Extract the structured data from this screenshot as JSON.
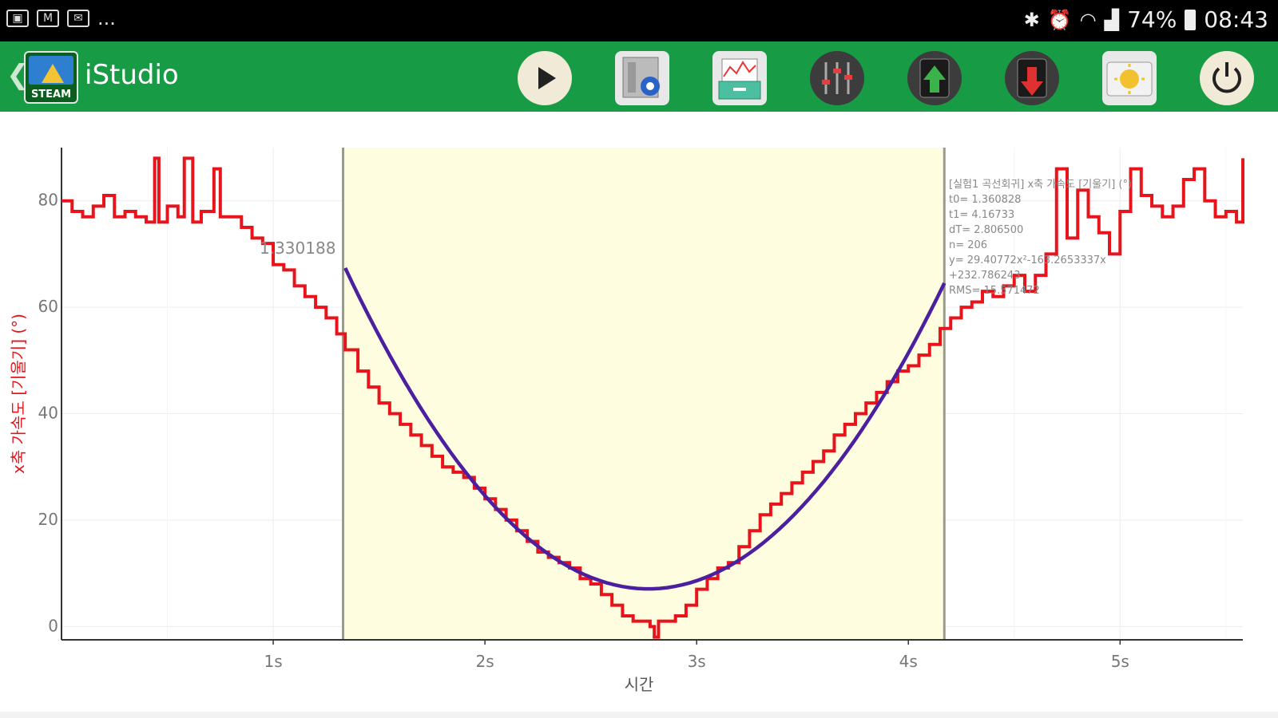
{
  "status_bar": {
    "overflow": "...",
    "battery": "74%",
    "time": "08:43",
    "left_icons": [
      "gallery-icon",
      "gmail-icon",
      "mail-icon"
    ],
    "right_icons": [
      "bluetooth-icon",
      "alarm-icon",
      "wifi-icon",
      "signal-icon",
      "battery-icon"
    ]
  },
  "app_bar": {
    "title": "iStudio",
    "logo_text": "STEAM",
    "color": "#179b44",
    "toolbar": [
      {
        "icon": "play-icon"
      },
      {
        "icon": "settings-icon"
      },
      {
        "icon": "data-box-icon"
      },
      {
        "icon": "equalizer-icon"
      },
      {
        "icon": "upload-sd-icon"
      },
      {
        "icon": "download-sd-icon"
      },
      {
        "icon": "sun-camera-icon"
      },
      {
        "icon": "power-icon"
      }
    ]
  },
  "chart_data": {
    "type": "line",
    "xlabel": "시간",
    "ylabel": "x축 가속도 [기울기] (°)",
    "xlim": [
      0.0,
      5.58
    ],
    "ylim": [
      -2.5,
      90
    ],
    "x_ticks": [
      1,
      2,
      3,
      4,
      5
    ],
    "x_tick_labels": [
      "1s",
      "2s",
      "3s",
      "4s",
      "5s"
    ],
    "y_ticks": [
      0,
      20,
      40,
      60,
      80
    ],
    "y_tick_labels": [
      "0",
      "20",
      "40",
      "60",
      "80"
    ],
    "grid": true,
    "series_color": "#e8141c",
    "fit_color": "#4b1fa0",
    "selection": {
      "t0": 1.33,
      "t1": 4.17,
      "fill": "#fffddf"
    },
    "cursor_label": "1.330188",
    "data": [
      [
        0.0,
        80
      ],
      [
        0.05,
        78
      ],
      [
        0.1,
        77
      ],
      [
        0.15,
        79
      ],
      [
        0.2,
        81
      ],
      [
        0.25,
        77
      ],
      [
        0.3,
        78
      ],
      [
        0.35,
        77
      ],
      [
        0.4,
        76
      ],
      [
        0.44,
        88
      ],
      [
        0.46,
        76
      ],
      [
        0.5,
        79
      ],
      [
        0.55,
        77
      ],
      [
        0.58,
        88
      ],
      [
        0.62,
        76
      ],
      [
        0.66,
        78
      ],
      [
        0.7,
        78
      ],
      [
        0.72,
        86
      ],
      [
        0.75,
        77
      ],
      [
        0.8,
        77
      ],
      [
        0.85,
        75
      ],
      [
        0.9,
        73
      ],
      [
        0.95,
        72
      ],
      [
        1.0,
        68
      ],
      [
        1.05,
        67
      ],
      [
        1.1,
        64
      ],
      [
        1.15,
        62
      ],
      [
        1.2,
        60
      ],
      [
        1.25,
        58
      ],
      [
        1.3,
        55
      ],
      [
        1.34,
        52
      ],
      [
        1.4,
        48
      ],
      [
        1.45,
        45
      ],
      [
        1.5,
        42
      ],
      [
        1.55,
        40
      ],
      [
        1.6,
        38
      ],
      [
        1.65,
        36
      ],
      [
        1.7,
        34
      ],
      [
        1.75,
        32
      ],
      [
        1.8,
        30
      ],
      [
        1.85,
        29
      ],
      [
        1.9,
        28
      ],
      [
        1.95,
        26
      ],
      [
        2.0,
        24
      ],
      [
        2.05,
        22
      ],
      [
        2.1,
        20
      ],
      [
        2.15,
        18
      ],
      [
        2.2,
        16
      ],
      [
        2.25,
        14
      ],
      [
        2.3,
        13
      ],
      [
        2.35,
        12
      ],
      [
        2.4,
        11
      ],
      [
        2.45,
        9
      ],
      [
        2.5,
        8
      ],
      [
        2.55,
        6
      ],
      [
        2.6,
        4
      ],
      [
        2.65,
        2
      ],
      [
        2.7,
        1
      ],
      [
        2.73,
        1
      ],
      [
        2.78,
        0
      ],
      [
        2.8,
        -2
      ],
      [
        2.82,
        1
      ],
      [
        2.85,
        1
      ],
      [
        2.9,
        2
      ],
      [
        2.95,
        4
      ],
      [
        3.0,
        7
      ],
      [
        3.05,
        9
      ],
      [
        3.1,
        11
      ],
      [
        3.15,
        12
      ],
      [
        3.2,
        15
      ],
      [
        3.25,
        18
      ],
      [
        3.3,
        21
      ],
      [
        3.35,
        23
      ],
      [
        3.4,
        25
      ],
      [
        3.45,
        27
      ],
      [
        3.5,
        29
      ],
      [
        3.55,
        31
      ],
      [
        3.6,
        33
      ],
      [
        3.65,
        36
      ],
      [
        3.7,
        38
      ],
      [
        3.75,
        40
      ],
      [
        3.8,
        42
      ],
      [
        3.85,
        44
      ],
      [
        3.9,
        46
      ],
      [
        3.95,
        48
      ],
      [
        4.0,
        49
      ],
      [
        4.05,
        51
      ],
      [
        4.1,
        53
      ],
      [
        4.15,
        56
      ],
      [
        4.2,
        58
      ],
      [
        4.25,
        60
      ],
      [
        4.3,
        61
      ],
      [
        4.35,
        63
      ],
      [
        4.4,
        62
      ],
      [
        4.45,
        64
      ],
      [
        4.5,
        66
      ],
      [
        4.55,
        63
      ],
      [
        4.6,
        66
      ],
      [
        4.65,
        70
      ],
      [
        4.7,
        86
      ],
      [
        4.75,
        73
      ],
      [
        4.8,
        82
      ],
      [
        4.85,
        77
      ],
      [
        4.9,
        74
      ],
      [
        4.95,
        70
      ],
      [
        5.0,
        78
      ],
      [
        5.05,
        86
      ],
      [
        5.1,
        81
      ],
      [
        5.15,
        79
      ],
      [
        5.2,
        77
      ],
      [
        5.25,
        79
      ],
      [
        5.3,
        84
      ],
      [
        5.35,
        86
      ],
      [
        5.4,
        80
      ],
      [
        5.45,
        77
      ],
      [
        5.5,
        78
      ],
      [
        5.55,
        76
      ],
      [
        5.58,
        88
      ]
    ],
    "fit": {
      "a": 29.4,
      "b": -163.0,
      "c": 233.0,
      "x_start": 1.34,
      "x_end": 4.17
    },
    "annotation": {
      "lines": [
        "[실험1 곡선회귀] x축 가속도 [기울기] (°)",
        "t0= 1.360828",
        "t1= 4.16733",
        "dT= 2.806500",
        "n= 206",
        "y= 29.40772x²-163.2653337x",
        "+232.786243",
        "RMS= 15.571472"
      ]
    }
  }
}
